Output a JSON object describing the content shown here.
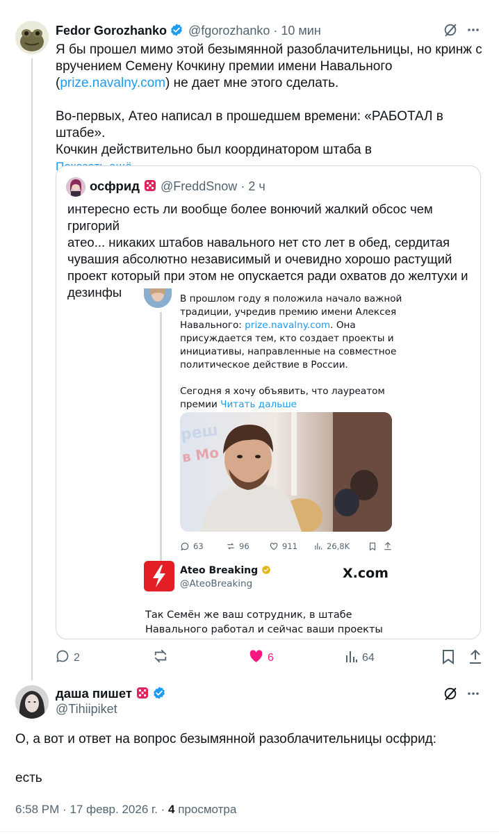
{
  "colors": {
    "accent": "#1d9bf0",
    "text": "#0f1419",
    "muted": "#536471",
    "like": "#f91880",
    "border": "#cfd9de",
    "verified": "#1d9bf0",
    "gold": "#e2b719"
  },
  "tweet1": {
    "author_name": "Fedor Gorozhanko",
    "handle": "@fgorozhanko",
    "separator": "·",
    "time": "10 мин",
    "body": {
      "line1": "Я бы прошел мимо этой безымянной разоблачительницы, но кринж с",
      "line2": "вручением Семену Кочкину премии имени Навального",
      "line3_open": "(",
      "line3_link": "prize.navalny.com",
      "line3_rest": ") не дает мне этого сделать.",
      "para2_line1": "Во-первых, Атео написал в прошедшем времени: «РАБОТАЛ в штабе».",
      "para2_line2": "Кочкин действительно был координатором штаба в",
      "show_more": "Показать ещё"
    },
    "icons": [
      "grok-icon",
      "more-icon"
    ],
    "actions": {
      "replies": "2",
      "likes": "6",
      "views": "64"
    }
  },
  "quote": {
    "author_name": "осфрид",
    "emoji": "dice-icon",
    "handle": "@FreddSnow",
    "separator": "·",
    "time": "2 ч",
    "body": {
      "l1": "интересно есть ли вообще более вонючий жалкий обсос чем григорий",
      "l2": "атео... никаких штабов навального нет сто лет в обед, сердитая",
      "l3": "чувашия абсолютно независимый и очевидно хорошо растущий",
      "l4": "проект который при этом не опускается ради охватов до желтухи и",
      "l5": "дезинфы в отличие от"
    },
    "screenshot": {
      "text_l1": "В прошлом году я положила начало важной",
      "text_l2": "традиции, учредив премию имени Алексея",
      "text_l3_pre": "Навального: ",
      "text_l3_link": "prize.navalny.com",
      "text_l3_post": ". Она",
      "text_l4": "присуждается тем, кто создает проекты и",
      "text_l5": "инициативы, направленные на совместное",
      "text_l6": "политическое действие в России.",
      "text_l7": "Сегодня я хочу объявить, что лауреатом",
      "text_l8_pre": "премии ",
      "text_l8_link": "Читать дальше",
      "actions": {
        "replies": "63",
        "reposts": "96",
        "likes": "911",
        "views": "26,8K"
      },
      "card_name": "Ateo Breaking",
      "card_handle": "@AteoBreaking",
      "card_site": "X.com",
      "card_text_l1": "Так Семён же ваш сотрудник, в штабе",
      "card_text_l2": "Навального работал и сейчас ваши проекты"
    }
  },
  "reply": {
    "author_name": "даша пишет",
    "emoji": "dice-icon",
    "handle": "@Tihiipiket",
    "text": "О, а вот и ответ на вопрос безымянной разоблачительницы осфрид:",
    "text2": "есть",
    "meta_time": "6:58 PM",
    "meta_sep1": "·",
    "meta_date": "17 февр. 2026 г.",
    "meta_sep2": "·",
    "meta_views_count": "4",
    "meta_views_label": "просмотра"
  }
}
